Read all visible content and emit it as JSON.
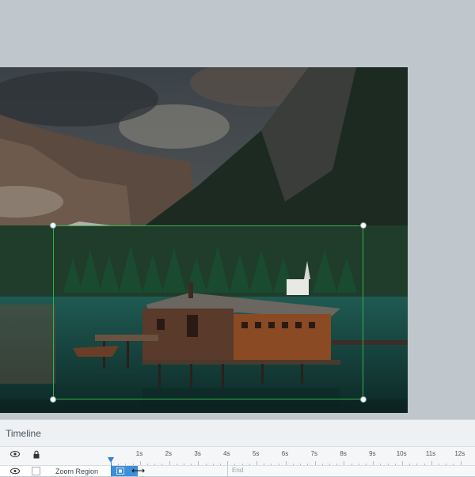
{
  "timeline": {
    "title": "Timeline",
    "ruler_labels": [
      "1s",
      "2s",
      "3s",
      "4s",
      "5s",
      "6s",
      "7s",
      "8s",
      "9s",
      "10s",
      "11s",
      "12s"
    ],
    "track": {
      "name": "Zoom Region",
      "end_label": "End"
    }
  },
  "icons": {
    "visibility": "eye-icon",
    "lock": "lock-icon",
    "zoom_region": "zoom-region-icon",
    "resize_cursor": "horizontal-resize-cursor-icon"
  },
  "colors": {
    "zoom_outline": "#34b24a",
    "track_block": "#3d8fd8",
    "playhead": "#2f7fd6",
    "workspace_bg": "#c0c7cc"
  }
}
